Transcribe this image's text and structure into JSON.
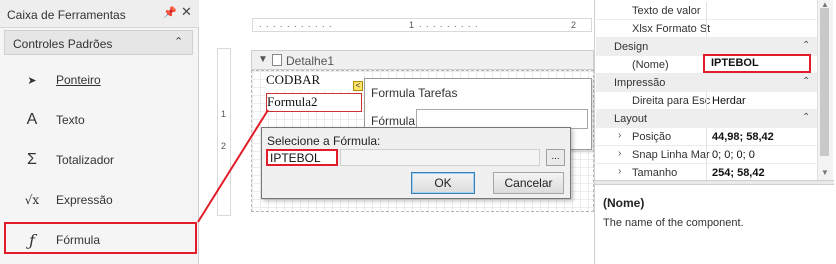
{
  "toolbox": {
    "title": "Caixa de Ferramentas",
    "group": "Controles Padrões",
    "items": [
      {
        "label": "Ponteiro",
        "icon": "pointer-icon",
        "glyph": "➤"
      },
      {
        "label": "Texto",
        "icon": "text-a-icon",
        "glyph": "A"
      },
      {
        "label": "Totalizador",
        "icon": "sigma-icon",
        "glyph": "Σ"
      },
      {
        "label": "Expressão",
        "icon": "sqrt-x-icon",
        "glyph": "√x"
      },
      {
        "label": "Fórmula",
        "icon": "function-f-icon",
        "glyph": "ƒ"
      }
    ]
  },
  "designer": {
    "ruler_top_marks": [
      ". . . . . . . . . . .",
      "1",
      ". . . . . . . . .",
      "2"
    ],
    "ruler_left_marks": [
      "1",
      "2"
    ],
    "band_title": "Detalhe1",
    "labels": {
      "codbar": "CODBAR",
      "formula": "Formula2"
    },
    "tasks": {
      "title": "Formula Tarefas",
      "formula_label": "Fórmula"
    },
    "dialog": {
      "prompt": "Selecione a Fórmula:",
      "value": "IPTEBOL",
      "browse": "...",
      "ok": "OK",
      "cancel": "Cancelar"
    }
  },
  "properties": {
    "rows_top": [
      {
        "name": "Texto de valor",
        "value": ""
      },
      {
        "name": "Xlsx Formato St",
        "value": ""
      }
    ],
    "design": {
      "label": "Design",
      "rows": [
        {
          "name": "(Nome)",
          "value": "IPTEBOL"
        }
      ]
    },
    "impressao": {
      "label": "Impressão",
      "rows": [
        {
          "name": "Direita para Esc",
          "value": "Herdar"
        }
      ]
    },
    "layout": {
      "label": "Layout",
      "rows": [
        {
          "name": "Posição",
          "value": "44,98; 58,42"
        },
        {
          "name": "Snap Linha Mar",
          "value": "0; 0; 0; 0"
        },
        {
          "name": "Tamanho",
          "value": "254; 58,42"
        }
      ]
    },
    "description": {
      "title": "(Nome)",
      "text": "The name of the component."
    }
  },
  "colors": {
    "highlight": "#e21c2a"
  }
}
